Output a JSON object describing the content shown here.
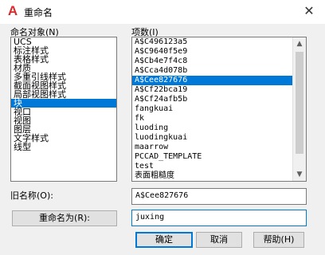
{
  "window": {
    "title": "重命名",
    "close_glyph": "✕"
  },
  "object_list": {
    "label": "命名对象(N)",
    "items": [
      "UCS",
      "标注样式",
      "表格样式",
      "材质",
      "多重引线样式",
      "截面视图样式",
      "局部视图样式",
      "块",
      "视口",
      "视图",
      "图层",
      "文字样式",
      "线型"
    ],
    "selected_index": 7
  },
  "item_list": {
    "label": "项数(I)",
    "items": [
      "A$C496123a5",
      "A$C9640f5e9",
      "A$Cb4e7f4c8",
      "A$Cca4d078b",
      "A$Cee827676",
      "A$Cf22bca19",
      "A$Cf24afb5b",
      "fangkuai",
      "fk",
      "luoding",
      "luodingkuai",
      "maarrow",
      "PCCAD_TEMPLATE",
      "test",
      "表面粗糙度"
    ],
    "selected_index": 4
  },
  "old_name": {
    "label": "旧名称(O):",
    "value": "A$Cee827676"
  },
  "rename_to": {
    "button_label": "重命名为(R):",
    "value": "juxing"
  },
  "buttons": {
    "ok": "确定",
    "cancel": "取消",
    "help": "帮助(H)"
  },
  "colors": {
    "selection": "#0078d7",
    "app_icon": "#d92b2b"
  }
}
